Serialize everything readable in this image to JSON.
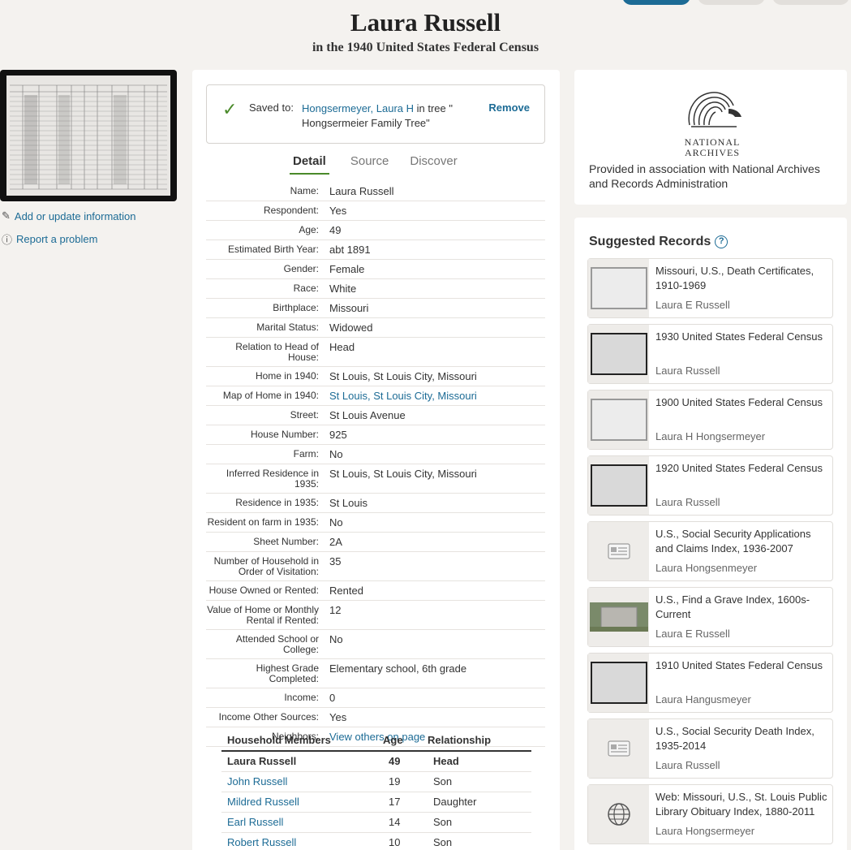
{
  "header": {
    "title": "Laura Russell",
    "subtitle": "in the 1940 United States Federal Census"
  },
  "left": {
    "add_update": "Add or update information",
    "report": "Report a problem"
  },
  "saved": {
    "label": "Saved to:",
    "person": "Hongsermeyer, Laura H",
    "tree_text": " in tree \" Hongsermeier Family Tree\"",
    "remove": "Remove"
  },
  "tabs": [
    "Detail",
    "Source",
    "Discover"
  ],
  "details": [
    {
      "k": "Name:",
      "v": "Laura Russell"
    },
    {
      "k": "Respondent:",
      "v": "Yes"
    },
    {
      "k": "Age:",
      "v": "49"
    },
    {
      "k": "Estimated Birth Year:",
      "v": "abt 1891"
    },
    {
      "k": "Gender:",
      "v": "Female"
    },
    {
      "k": "Race:",
      "v": "White"
    },
    {
      "k": "Birthplace:",
      "v": "Missouri"
    },
    {
      "k": "Marital Status:",
      "v": "Widowed"
    },
    {
      "k": "Relation to Head of House:",
      "v": "Head"
    },
    {
      "k": "Home in 1940:",
      "v": "St Louis, St Louis City, Missouri"
    },
    {
      "k": "Map of Home in 1940:",
      "v": "St Louis, St Louis City, Missouri",
      "link": true
    },
    {
      "k": "Street:",
      "v": "St Louis Avenue"
    },
    {
      "k": "House Number:",
      "v": "925"
    },
    {
      "k": "Farm:",
      "v": "No"
    },
    {
      "k": "Inferred Residence in 1935:",
      "v": "St Louis, St Louis City, Missouri"
    },
    {
      "k": "Residence in 1935:",
      "v": "St Louis"
    },
    {
      "k": "Resident on farm in 1935:",
      "v": "No"
    },
    {
      "k": "Sheet Number:",
      "v": "2A"
    },
    {
      "k": "Number of Household in Order of Visitation:",
      "v": "35"
    },
    {
      "k": "House Owned or Rented:",
      "v": "Rented"
    },
    {
      "k": "Value of Home or Monthly Rental if Rented:",
      "v": "12"
    },
    {
      "k": "Attended School or College:",
      "v": "No"
    },
    {
      "k": "Highest Grade Completed:",
      "v": "Elementary school, 6th grade"
    },
    {
      "k": "Income:",
      "v": "0"
    },
    {
      "k": "Income Other Sources:",
      "v": "Yes"
    },
    {
      "k": "Neighbors:",
      "v": "View others on page",
      "link": true
    }
  ],
  "household": {
    "headers": [
      "Household Members",
      "Age",
      "Relationship"
    ],
    "rows": [
      {
        "name": "Laura Russell",
        "age": "49",
        "rel": "Head",
        "bold": true
      },
      {
        "name": "John Russell",
        "age": "19",
        "rel": "Son",
        "link": true
      },
      {
        "name": "Mildred Russell",
        "age": "17",
        "rel": "Daughter",
        "link": true
      },
      {
        "name": "Earl Russell",
        "age": "14",
        "rel": "Son",
        "link": true
      },
      {
        "name": "Robert Russell",
        "age": "10",
        "rel": "Son",
        "link": true
      }
    ]
  },
  "archives": {
    "logo_line1": "NATIONAL",
    "logo_line2": "ARCHIVES",
    "text": "Provided in association with National Archives and Records Administration"
  },
  "suggested": {
    "title": "Suggested Records",
    "help": "?",
    "cards": [
      {
        "title": "Missouri, U.S., Death Certificates, 1910-1969",
        "name": "Laura E Russell",
        "img": "doc-light"
      },
      {
        "title": "1930 United States Federal Census",
        "name": "Laura Russell",
        "img": "doc-dark"
      },
      {
        "title": "1900 United States Federal Census",
        "name": "Laura H Hongsermeyer",
        "img": "doc-light"
      },
      {
        "title": "1920 United States Federal Census",
        "name": "Laura Russell",
        "img": "doc-dark"
      },
      {
        "title": "U.S., Social Security Applications and Claims Index, 1936-2007",
        "name": "Laura Hongsenmeyer",
        "img": "card-icon"
      },
      {
        "title": "U.S., Find a Grave Index, 1600s-Current",
        "name": "Laura E Russell",
        "img": "grave"
      },
      {
        "title": "1910 United States Federal Census",
        "name": "Laura Hangusmeyer",
        "img": "doc-dark"
      },
      {
        "title": "U.S., Social Security Death Index, 1935-2014",
        "name": "Laura Russell",
        "img": "card-icon"
      },
      {
        "title": "Web: Missouri, U.S., St. Louis Public Library Obituary Index, 1880-2011",
        "name": "Laura Hongsermeyer",
        "img": "globe-icon"
      }
    ]
  }
}
